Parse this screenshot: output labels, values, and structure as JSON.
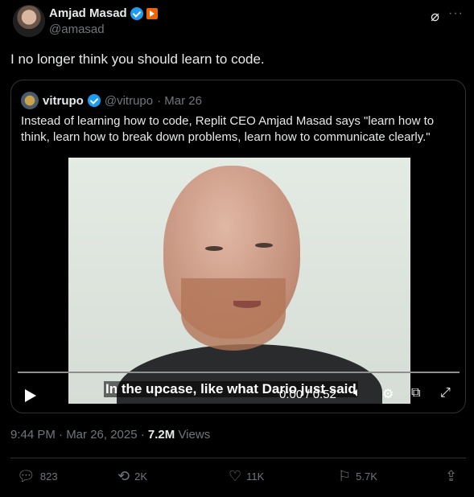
{
  "author": {
    "name": "Amjad Masad",
    "handle": "@amasad"
  },
  "header_icons": {
    "grok": "grok-icon",
    "more": "···"
  },
  "tweet": {
    "text": "I no longer think you should learn to code."
  },
  "quote": {
    "name": "vitrupo",
    "handle": "@vitrupo",
    "date": "· Mar 26",
    "text": "Instead of learning how to code, Replit CEO Amjad Masad says \"learn how to think, learn how to break down problems, learn how to communicate clearly.\""
  },
  "video": {
    "subtitle": "In the upcase, like what Dario just said",
    "time": "0:00 / 0:52",
    "progress": 0
  },
  "meta": {
    "time": "9:44 PM · Mar 26, 2025 · ",
    "views_count": "7.2M",
    "views_label": " Views"
  },
  "actions": {
    "replies": "823",
    "reposts": "2K",
    "likes": "11K",
    "bookmarks": "5.7K"
  },
  "colors": {
    "accent": "#1d9bf0",
    "secondary": "#71767b",
    "border": "#2f3336"
  }
}
